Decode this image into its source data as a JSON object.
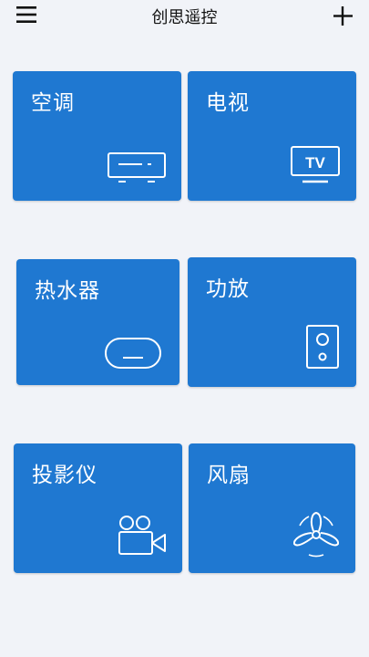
{
  "header": {
    "title": "创思遥控",
    "menu_icon": "hamburger-menu-icon",
    "add_icon": "plus-icon"
  },
  "colors": {
    "background": "#f1f3f8",
    "card": "#1f78d1",
    "card_text": "#ffffff"
  },
  "devices": [
    {
      "label": "空调",
      "icon": "air-conditioner-icon"
    },
    {
      "label": "电视",
      "icon": "tv-icon"
    },
    {
      "label": "热水器",
      "icon": "water-heater-icon"
    },
    {
      "label": "功放",
      "icon": "speaker-icon"
    },
    {
      "label": "投影仪",
      "icon": "video-camera-icon"
    },
    {
      "label": "风扇",
      "icon": "fan-icon"
    }
  ]
}
